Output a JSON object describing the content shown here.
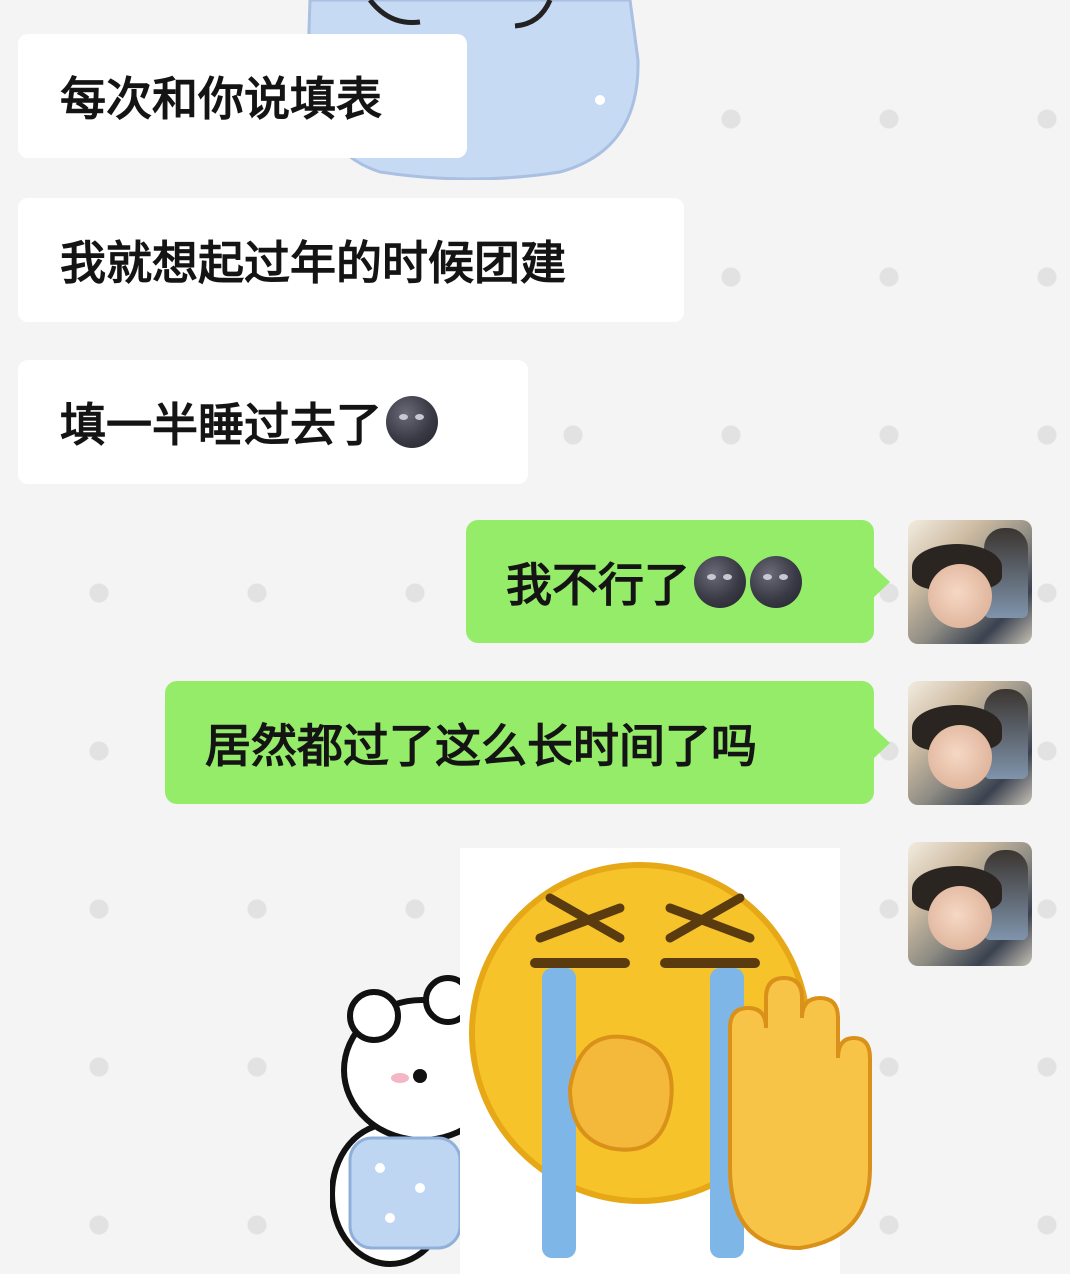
{
  "chat": {
    "messages": [
      {
        "side": "in",
        "text": "每次和你说填表",
        "moons": 0
      },
      {
        "side": "in",
        "text": "我就想起过年的时候团建",
        "moons": 0
      },
      {
        "side": "in",
        "text": "填一半睡过去了",
        "moons": 1
      },
      {
        "side": "out",
        "text": "我不行了",
        "moons": 2
      },
      {
        "side": "out",
        "text": "居然都过了这么长时间了吗",
        "moons": 0
      }
    ],
    "colors": {
      "incoming_bubble": "#ffffff",
      "outgoing_bubble": "#95ec69",
      "background": "#f4f4f4"
    },
    "icons": [
      "new-moon-face-emoji",
      "user-avatar",
      "bear-sticker",
      "crying-emoji-sticker"
    ]
  }
}
